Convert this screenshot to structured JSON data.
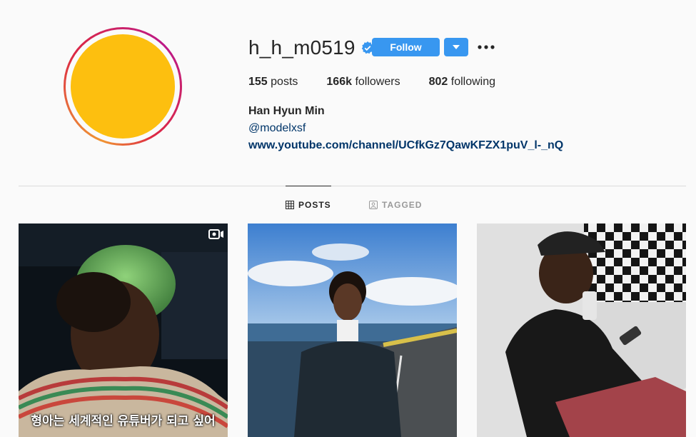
{
  "profile": {
    "username": "h_h_m0519",
    "verified": true,
    "full_name": "Han Hyun Min",
    "handle_link": "@modelxsf",
    "website": "www.youtube.com/channel/UCfkGz7QawKFZX1puV_l-_nQ",
    "avatar_color": "#fdbf0f"
  },
  "actions": {
    "follow_label": "Follow",
    "dropdown_icon": "chevron-down-icon",
    "more_icon": "more-options-icon"
  },
  "stats": {
    "posts_count": "155",
    "posts_label": "posts",
    "followers_count": "166k",
    "followers_label": "followers",
    "following_count": "802",
    "following_label": "following"
  },
  "tabs": [
    {
      "label": "POSTS",
      "icon": "grid-icon",
      "active": true
    },
    {
      "label": "TAGGED",
      "icon": "tagged-icon",
      "active": false
    }
  ],
  "posts": [
    {
      "type": "igtv",
      "caption": "형아는 세계적인 유튜버가 되고 싶어"
    },
    {
      "type": "photo",
      "caption": ""
    },
    {
      "type": "photo",
      "caption": ""
    }
  ],
  "colors": {
    "accent": "#3897f0",
    "link": "#003569",
    "verified": "#3897f0"
  }
}
